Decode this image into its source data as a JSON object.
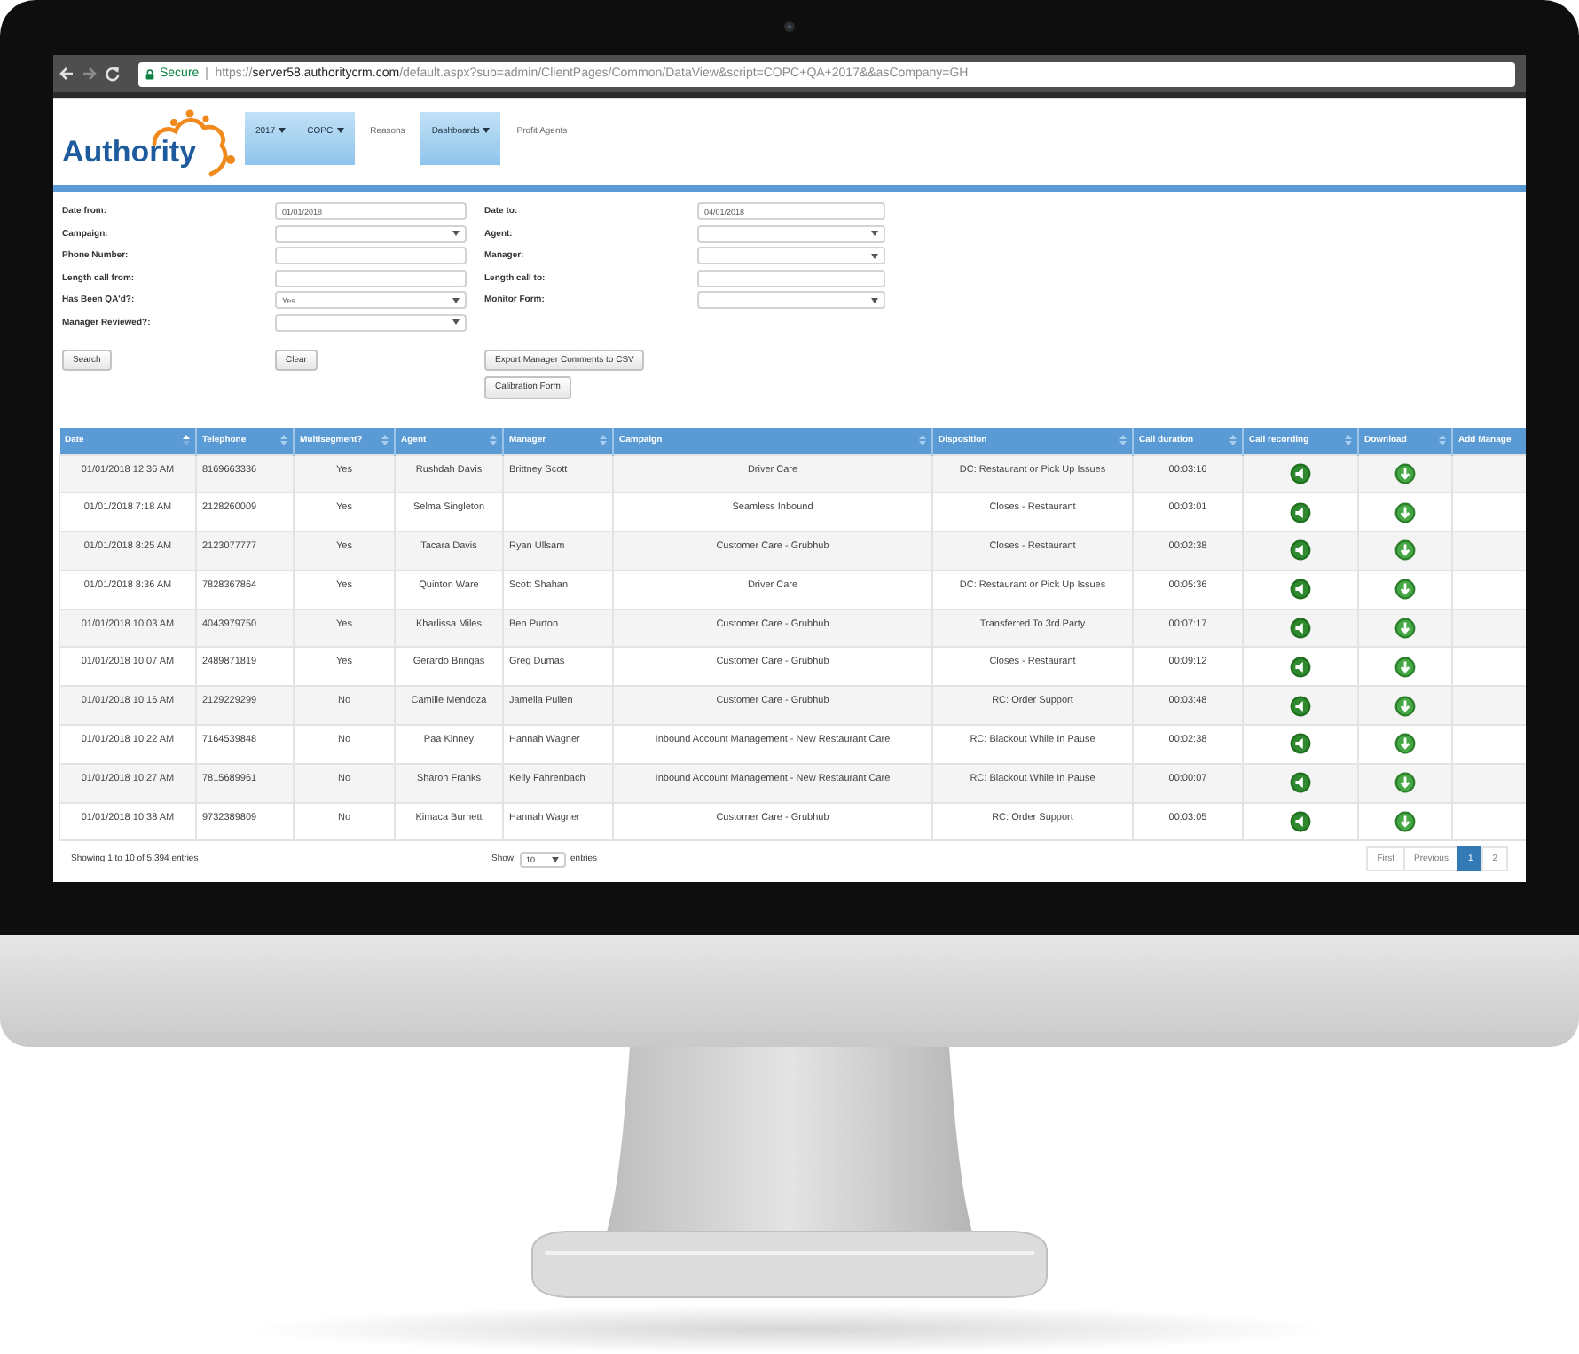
{
  "browser": {
    "secure_label": "Secure",
    "url": "https://**server58.authoritycrm.com**/default.aspx?sub=admin/ClientPages/Common/DataView&script=COPC+QA+2017&&asCompany=GH"
  },
  "header": {
    "logo": "Authority",
    "nav": [
      {
        "label": "2017",
        "kind": "dropdown"
      },
      {
        "label": "COPC",
        "kind": "dropdown"
      },
      {
        "label": "Reasons",
        "kind": "link"
      },
      {
        "label": "Dashboards",
        "kind": "dropdown"
      },
      {
        "label": "Profit Agents",
        "kind": "link"
      }
    ]
  },
  "filters": {
    "left": [
      {
        "label": "Date from:",
        "kind": "text",
        "value": "01/01/2018"
      },
      {
        "label": "Campaign:",
        "kind": "select"
      },
      {
        "label": "Phone Number:",
        "kind": "text"
      },
      {
        "label": "Length call from:",
        "kind": "text"
      },
      {
        "label": "Has Been QA'd?:",
        "kind": "select",
        "value": "Yes"
      },
      {
        "label": "Manager Reviewed?:",
        "kind": "select"
      }
    ],
    "right": [
      {
        "label": "Date to:",
        "kind": "text",
        "value": "04/01/2018"
      },
      {
        "label": "Agent:",
        "kind": "select"
      },
      {
        "label": "Manager:",
        "kind": "select"
      },
      {
        "label": "Length call to:",
        "kind": "text"
      },
      {
        "label": "Monitor Form:",
        "kind": "select"
      }
    ]
  },
  "buttons": [
    {
      "label": "Search"
    },
    {
      "label": "Clear"
    },
    {
      "label": "Export Manager Comments to CSV"
    },
    {
      "label": "Calibration Form"
    }
  ],
  "table": {
    "columns": [
      {
        "label": "Date",
        "kind": "text",
        "sorted": true
      },
      {
        "label": "Telephone",
        "kind": "text",
        "sorted": false
      },
      {
        "label": "Multisegment?",
        "kind": "text",
        "sorted": false
      },
      {
        "label": "Agent",
        "kind": "text",
        "sorted": false
      },
      {
        "label": "Manager",
        "kind": "text",
        "sorted": false
      },
      {
        "label": "Campaign",
        "kind": "text",
        "sorted": false
      },
      {
        "label": "Disposition",
        "kind": "text",
        "sorted": false
      },
      {
        "label": "Call duration",
        "kind": "text",
        "sorted": false
      },
      {
        "label": "Call recording",
        "kind": "recording",
        "sorted": false
      },
      {
        "label": "Download",
        "kind": "download",
        "sorted": false
      },
      {
        "label": "Add Manage",
        "kind": "blank"
      }
    ],
    "rows": [
      {
        "date": "01/01/2018 12:36 AM",
        "telephone": "8169663336",
        "multisegment": "Yes",
        "agent": "Rushdah Davis",
        "manager": "Brittney Scott",
        "campaign": "Driver Care",
        "disposition": "DC: Restaurant or Pick Up Issues",
        "duration": "00:03:16"
      },
      {
        "date": "01/01/2018 7:18 AM",
        "telephone": "2128260009",
        "multisegment": "Yes",
        "agent": "Selma Singleton",
        "campaign": "Seamless Inbound",
        "disposition": "Closes - Restaurant",
        "duration": "00:03:01"
      },
      {
        "date": "01/01/2018 8:25 AM",
        "telephone": "2123077777",
        "multisegment": "Yes",
        "agent": "Tacara Davis",
        "manager": "Ryan Ullsam",
        "campaign": "Customer Care - Grubhub",
        "disposition": "Closes - Restaurant",
        "duration": "00:02:38"
      },
      {
        "date": "01/01/2018 8:36 AM",
        "telephone": "7828367864",
        "multisegment": "Yes",
        "agent": "Quinton Ware",
        "manager": "Scott Shahan",
        "campaign": "Driver Care",
        "disposition": "DC: Restaurant or Pick Up Issues",
        "duration": "00:05:36"
      },
      {
        "date": "01/01/2018 10:03 AM",
        "telephone": "4043979750",
        "multisegment": "Yes",
        "agent": "Kharlissa Miles",
        "manager": "Ben Purton",
        "campaign": "Customer Care - Grubhub",
        "disposition": "Transferred To 3rd Party",
        "duration": "00:07:17"
      },
      {
        "date": "01/01/2018 10:07 AM",
        "telephone": "2489871819",
        "multisegment": "Yes",
        "agent": "Gerardo Bringas",
        "manager": "Greg Dumas",
        "campaign": "Customer Care - Grubhub",
        "disposition": "Closes - Restaurant",
        "duration": "00:09:12"
      },
      {
        "date": "01/01/2018 10:16 AM",
        "telephone": "2129229299",
        "multisegment": "No",
        "agent": "Camille Mendoza",
        "manager": "Jamella Pullen",
        "campaign": "Customer Care - Grubhub",
        "disposition": "RC: Order Support",
        "duration": "00:03:48"
      },
      {
        "date": "01/01/2018 10:22 AM",
        "telephone": "7164539848",
        "multisegment": "No",
        "agent": "Paa Kinney",
        "manager": "Hannah Wagner",
        "campaign": "Inbound Account Management - New Restaurant Care",
        "disposition": "RC: Blackout While In Pause",
        "duration": "00:02:38"
      },
      {
        "date": "01/01/2018 10:27 AM",
        "telephone": "7815689961",
        "multisegment": "No",
        "agent": "Sharon Franks",
        "manager": "Kelly Fahrenbach",
        "campaign": "Inbound Account Management - New Restaurant Care",
        "disposition": "RC: Blackout While In Pause",
        "duration": "00:00:07"
      },
      {
        "date": "01/01/2018 10:38 AM",
        "telephone": "9732389809",
        "multisegment": "No",
        "agent": "Kimaca Burnett",
        "manager": "Hannah Wagner",
        "campaign": "Customer Care - Grubhub",
        "disposition": "RC: Order Support",
        "duration": "00:03:05"
      }
    ]
  },
  "footer": {
    "info": "Showing 1 to 10 of 5,394 entries",
    "length_before": "Show",
    "length_value": "10",
    "length_after": "entries",
    "pages": [
      {
        "label": "First",
        "selected": false
      },
      {
        "label": "Previous",
        "selected": false
      },
      {
        "label": "1",
        "selected": true
      },
      {
        "label": "2",
        "selected": false
      }
    ]
  }
}
